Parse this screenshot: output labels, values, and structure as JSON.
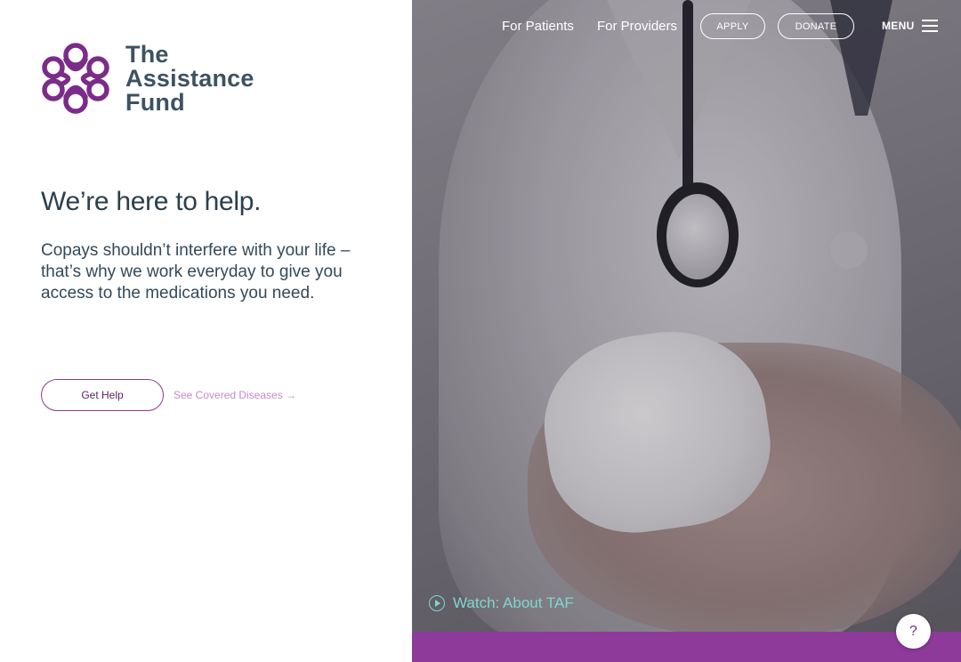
{
  "brand": {
    "name_line1": "The",
    "name_line2": "Assistance",
    "name_line3": "Fund",
    "logo_icon": "knot-flower-logo",
    "brand_color": "#7b2c88",
    "text_color": "#3d5262"
  },
  "nav": {
    "for_patients": "For Patients",
    "for_providers": "For Providers",
    "apply": "APPLY",
    "donate": "DONATE",
    "menu": "MENU"
  },
  "hero": {
    "headline": "We’re here to help.",
    "body": "Copays shouldn’t interfere with your life – that’s why we work everyday to give you access to the medications you need.",
    "get_help": "Get Help",
    "see_covered": "See Covered Diseases →",
    "watch": "Watch: About TAF"
  },
  "help": {
    "label": "?"
  },
  "colors": {
    "accent_purple": "#8d3a9a",
    "watch_teal": "#7fd6cf",
    "link_pink": "#c28bcb"
  }
}
